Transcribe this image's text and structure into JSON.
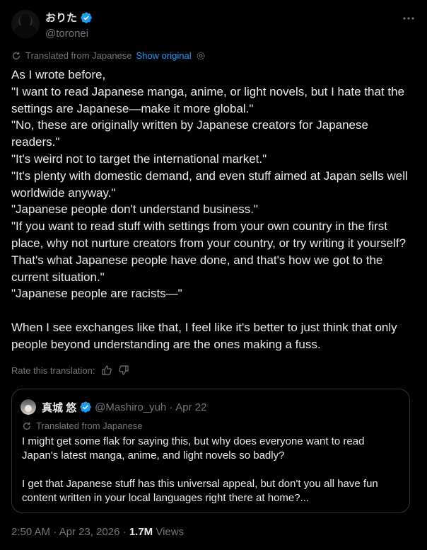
{
  "author": {
    "display_name": "おりた",
    "handle": "@toronei"
  },
  "translation": {
    "label": "Translated from Japanese",
    "show_original": "Show original"
  },
  "tweet": {
    "paragraphs": [
      "As I wrote before,",
      "\"I want to read Japanese manga, anime, or light novels, but I hate that the settings are Japanese—make it more global.\"",
      "\"No, these are originally written by Japanese creators for Japanese readers.\"",
      "\"It's weird not to target the international market.\"",
      "\"It's plenty with domestic demand, and even stuff aimed at Japan sells well worldwide anyway.\"",
      "\"Japanese people don't understand business.\"",
      "\"If you want to read stuff with settings from your own country in the first place, why not nurture creators from your country, or try writing it yourself? That's what Japanese people have done, and that's how we got to the current situation.\"",
      "\"Japanese people are racists—\"",
      "",
      "When I see exchanges like that, I feel like it's better to just think that only people beyond understanding are the ones making a fuss."
    ]
  },
  "rate": {
    "label": "Rate this translation:"
  },
  "quote": {
    "display_name": "真城 悠",
    "handle": "@Mashiro_yuh",
    "separator": "·",
    "date": "Apr 22",
    "translated_label": "Translated from Japanese",
    "paragraphs": [
      "I might get some flak for saying this, but why does everyone want to read Japan's latest manga, anime, and light novels so badly?",
      "",
      "I get that Japanese stuff has this universal appeal, but don't you all have fun content written in your local languages right there at home?..."
    ]
  },
  "footer": {
    "time": "2:50 AM",
    "separator": "·",
    "date": "Apr 23, 2026",
    "separator2": "·",
    "views_count": "1.7M",
    "views_label": "Views"
  },
  "colors": {
    "background": "#000000",
    "text": "#e7e9ea",
    "muted": "#71767b",
    "accent": "#1d9bf0",
    "border": "#2f3336"
  },
  "icons": [
    "verified-badge-icon",
    "more-icon",
    "translate-icon",
    "settings-gear-icon",
    "thumbs-up-icon",
    "thumbs-down-icon"
  ]
}
